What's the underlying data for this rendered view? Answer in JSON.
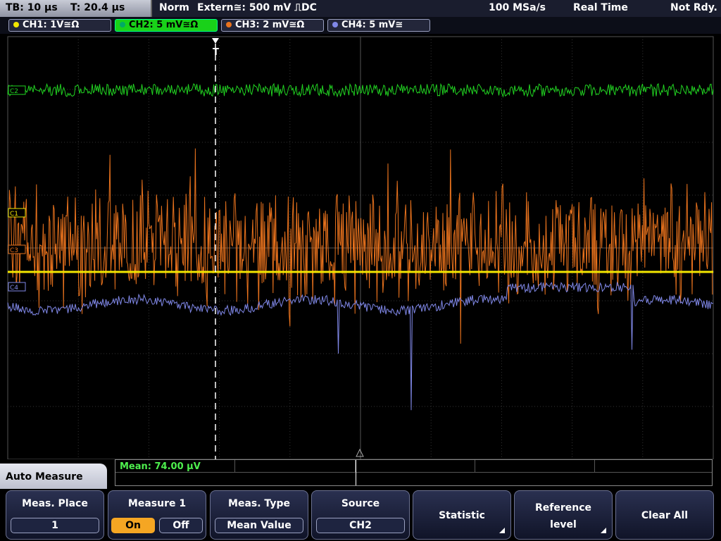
{
  "header": {
    "timebase": "TB: 10 µs",
    "trigger_time": "T: 20.4 µs",
    "trigger_mode": "Norm",
    "trigger_source": "Extern≅: 500 mV ⎍DC",
    "sample_rate": "100 MSa/s",
    "acq_mode": "Real Time",
    "status": "Not Rdy."
  },
  "channels": [
    {
      "label": "CH1: 1V≅Ω",
      "color": "#f2e600",
      "active": false
    },
    {
      "label": "CH2: 5 mV≅Ω",
      "color": "#21d321",
      "active": true
    },
    {
      "label": "CH3: 2 mV≅Ω",
      "color": "#e8721d",
      "active": false
    },
    {
      "label": "CH4: 5 mV≅",
      "color": "#8088e8",
      "active": false
    }
  ],
  "markers": {
    "c1": "C1",
    "c2": "C2",
    "c3": "C3",
    "c4": "C4",
    "trigger": "T"
  },
  "measure": {
    "menu_title": "Auto Measure",
    "readout": "Mean: 74.00 µV"
  },
  "softkeys": {
    "meas_place": {
      "label": "Meas. Place",
      "value": "1"
    },
    "measure1": {
      "label": "Measure 1",
      "on": "On",
      "off": "Off",
      "selected": "On"
    },
    "meas_type": {
      "label": "Meas. Type",
      "value": "Mean Value"
    },
    "source": {
      "label": "Source",
      "value": "CH2"
    },
    "statistic": {
      "label": "Statistic"
    },
    "reference": {
      "label1": "Reference",
      "label2": "level"
    },
    "clear_all": {
      "label": "Clear All"
    }
  },
  "colors": {
    "accent_on": "#f5a623",
    "grid": "#3a3a3a"
  }
}
